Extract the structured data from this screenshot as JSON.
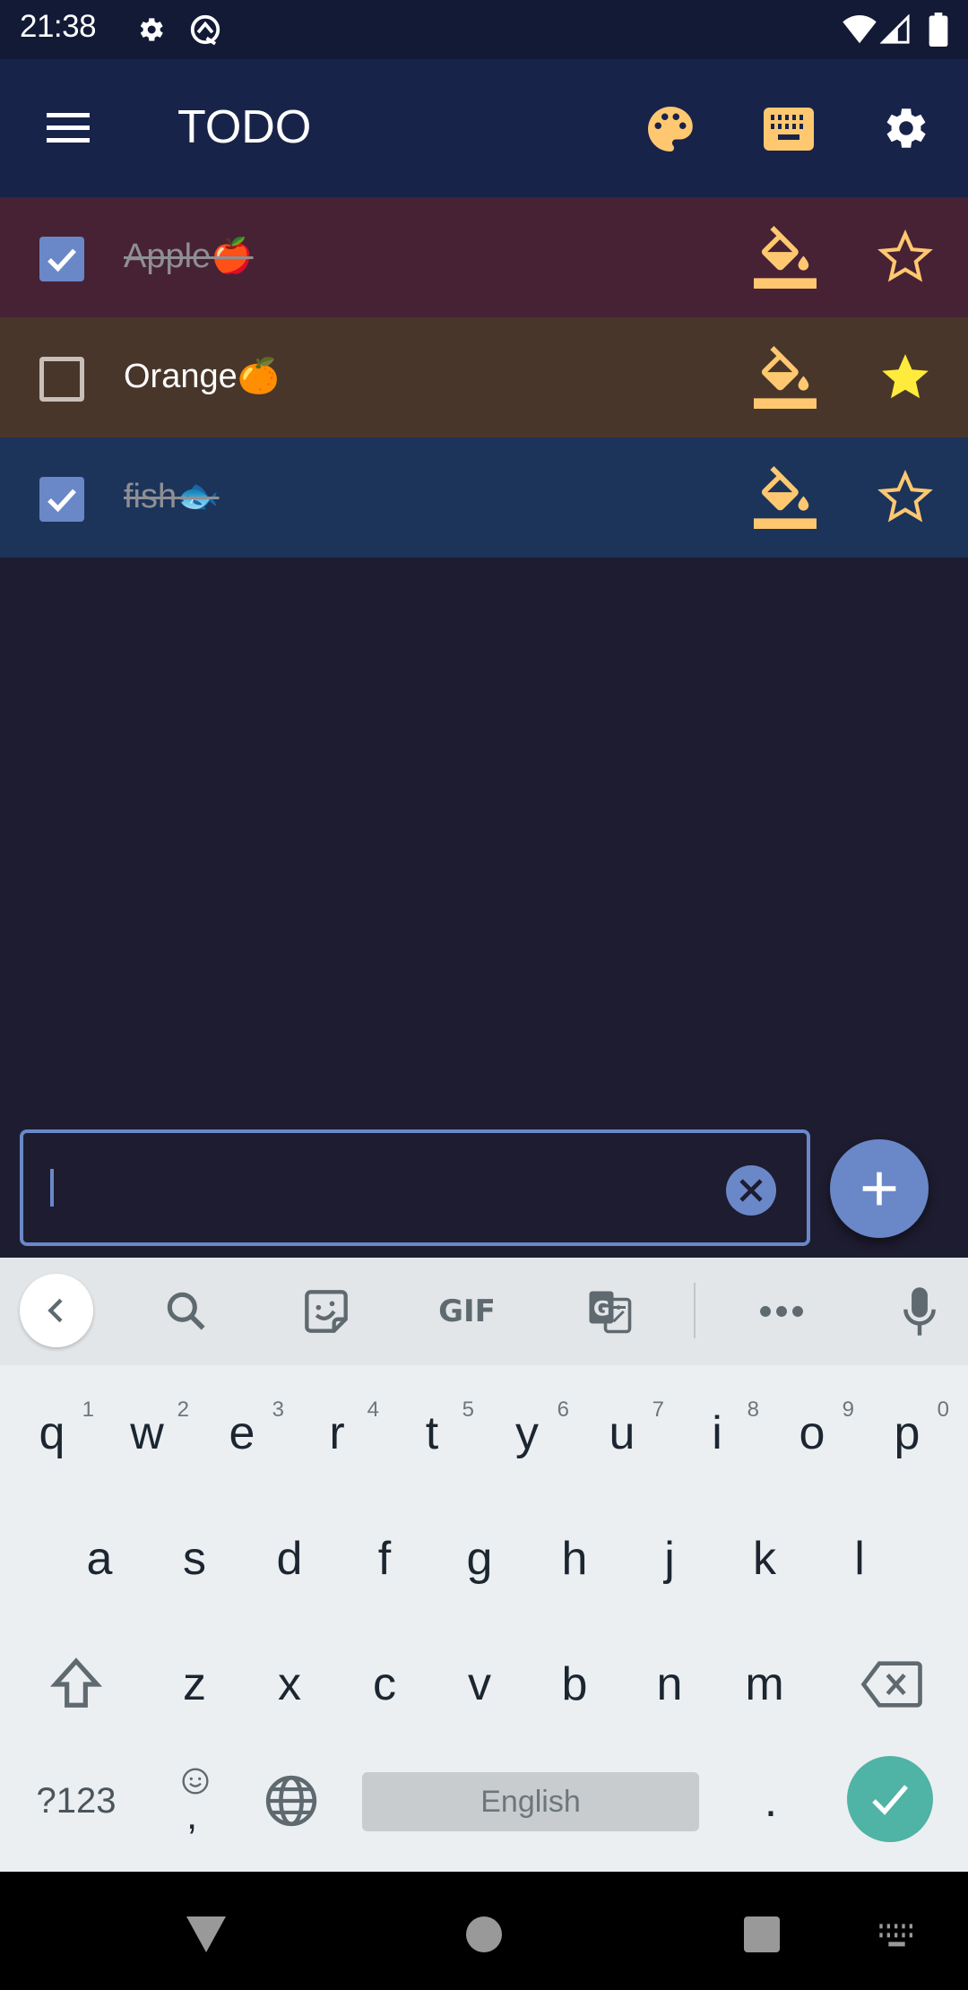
{
  "status_bar": {
    "time": "21:38",
    "icons": [
      "settings-icon",
      "q-app-icon",
      "wifi-icon",
      "signal-icon",
      "battery-icon"
    ]
  },
  "app_bar": {
    "title": "TODO",
    "menu_icon": "hamburger-menu-icon",
    "actions": [
      "palette-icon",
      "keyboard-icon",
      "settings-gear-icon"
    ],
    "accent_color": "#ffc870"
  },
  "todos": [
    {
      "text": "Apple",
      "emoji": "🍎",
      "done": true,
      "starred": false,
      "bg_color": "#472234"
    },
    {
      "text": "Orange",
      "emoji": "🍊",
      "done": false,
      "starred": true,
      "bg_color": "#48362a"
    },
    {
      "text": "fish",
      "emoji": "🐟",
      "done": true,
      "starred": false,
      "bg_color": "#1c345a"
    }
  ],
  "input": {
    "value": "",
    "placeholder": ""
  },
  "colors": {
    "primary": "#6a88c8",
    "background": "#1e1c30",
    "star_filled": "#ffeb3b",
    "icon_accent": "#ffc870"
  },
  "keyboard": {
    "toolbar": [
      "back-chevron-icon",
      "search-icon",
      "sticker-icon",
      "gif-icon",
      "translate-icon",
      "more-icon",
      "mic-icon"
    ],
    "gif_label": "GIF",
    "row1": [
      {
        "k": "q",
        "n": "1"
      },
      {
        "k": "w",
        "n": "2"
      },
      {
        "k": "e",
        "n": "3"
      },
      {
        "k": "r",
        "n": "4"
      },
      {
        "k": "t",
        "n": "5"
      },
      {
        "k": "y",
        "n": "6"
      },
      {
        "k": "u",
        "n": "7"
      },
      {
        "k": "i",
        "n": "8"
      },
      {
        "k": "o",
        "n": "9"
      },
      {
        "k": "p",
        "n": "0"
      }
    ],
    "row2": [
      "a",
      "s",
      "d",
      "f",
      "g",
      "h",
      "j",
      "k",
      "l"
    ],
    "row3": [
      "z",
      "x",
      "c",
      "v",
      "b",
      "n",
      "m"
    ],
    "symbols_label": "?123",
    "comma_label": ",",
    "space_label": "English",
    "period_label": ".",
    "enter_color": "#4fb3a5"
  },
  "nav_bar": {
    "buttons": [
      "back-triangle-icon",
      "home-circle-icon",
      "recents-square-icon",
      "keyboard-switch-icon"
    ]
  }
}
